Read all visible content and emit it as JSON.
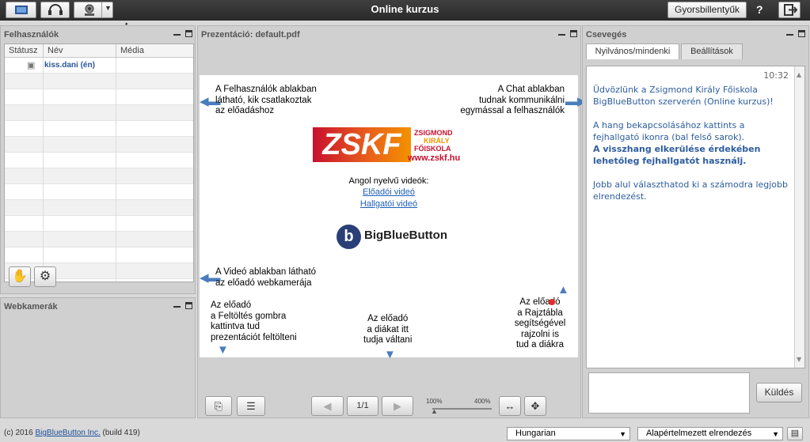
{
  "app": {
    "title": "Online kurzus",
    "shortcuts": "Gyorsbillentyűk",
    "help": "?"
  },
  "users": {
    "title": "Felhasználók",
    "cols": [
      "Státusz",
      "Név",
      "Média"
    ],
    "rows": [
      {
        "name": "kiss.dani (én)"
      }
    ]
  },
  "webcams": {
    "title": "Webkamerák"
  },
  "presentation": {
    "title": "Prezentáció: default.pdf",
    "page": "1/1",
    "zoom_min": "100%",
    "zoom_max": "400%",
    "slide": {
      "users_note": [
        "A Felhasználók ablakban",
        "látható, kik csatlakoztak",
        "az előadáshoz"
      ],
      "chat_note": [
        "A Chat ablakban",
        "tudnak kommunikálni",
        "egymással a felhasználók"
      ],
      "logo_main": "ZSKF",
      "logo_line1": "ZSIGMOND",
      "logo_line2": "KIRÁLY",
      "logo_line3": "FŐISKOLA",
      "logo_url": "www.zskf.hu",
      "videos_title": "Angol nyelvű videók:",
      "video1": "Előadói videó",
      "video2": "Hallgatói videó",
      "bbb": "BigBlueButton",
      "video_note": [
        "A Videó ablakban látható",
        "az előadó webkamerája"
      ],
      "upload_note": [
        "Az előadó",
        "a Feltöltés gombra",
        "kattintva tud",
        "prezentációt feltölteni"
      ],
      "slides_note": [
        "Az előadó",
        "a diákat itt",
        "tudja váltani"
      ],
      "whiteboard_note": [
        "Az előadó",
        "a Rajztábla",
        "segítségével",
        "rajzolni is",
        "tud a diákra"
      ]
    }
  },
  "chat": {
    "title": "Csevegés",
    "tab_public": "Nyilvános/mindenki",
    "tab_settings": "Beállítások",
    "time": "10:32",
    "msg1": "Üdvözlünk a Zsigmond Király Főiskola BigBlueButton szerverén (Online kurzus)!",
    "msg2a": "A hang bekapcsolásához kattints a fejhallgató ikonra (bal felső sarok).",
    "msg2b": "A visszhang elkerülése érdekében lehetőleg fejhallgatót használj.",
    "msg3": "Jobb alul választhatod ki a számodra legjobb elrendezést.",
    "send": "Küldés"
  },
  "footer": {
    "copyright": "(c) 2016 ",
    "link": "BigBlueButton Inc.",
    "build": " (build 419)",
    "language": "Hungarian",
    "layout": "Alapértelmezett elrendezés"
  },
  "colors": {
    "accent": "#4a7dbb",
    "chat_text": "#2d5d9e",
    "logo_red": "#c8102e",
    "logo_orange": "#f39200"
  }
}
